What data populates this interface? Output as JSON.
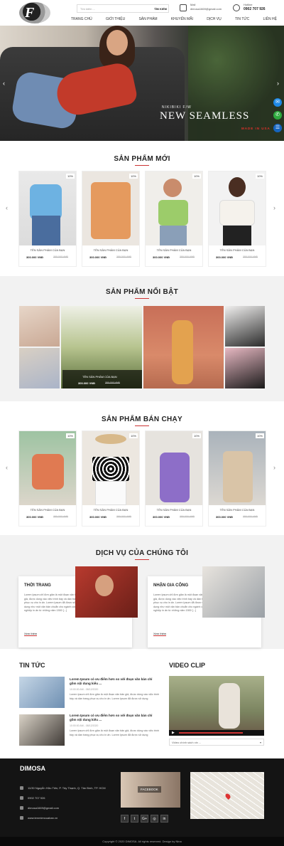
{
  "header": {
    "logo_letter": "F",
    "search_placeholder": "Tìm kiếm ...",
    "search_button": "TÌM KIẾM",
    "mail_label": "Mail",
    "mail_value": "dimosa1669@gmail.com",
    "hotline_label": "Hotline",
    "hotline_value": "0902 707 926",
    "nav": [
      "TRANG CHỦ",
      "GIỚI THIỆU",
      "SẢN PHẨM",
      "KHUYẾN MÃI",
      "DỊCH VỤ",
      "TIN TỨC",
      "LIÊN HỆ"
    ]
  },
  "hero": {
    "subtitle": "NIKIBIKI F/W",
    "title": "NEW SEAMLESS",
    "made": "MADE IN USA"
  },
  "floating": [
    "messenger-icon",
    "zalo-icon",
    "chat-icon"
  ],
  "new_products": {
    "title": "SẢN PHẨM MỚI",
    "items": [
      {
        "badge": "10%",
        "name": "TÊN SẢN PHẨM CỦA BẠN",
        "price": "300.000 VNĐ",
        "old": "350.000 VNĐ"
      },
      {
        "badge": "10%",
        "name": "TÊN SẢN PHẨM CỦA BẠN",
        "price": "300.000 VNĐ",
        "old": "350.000 VNĐ"
      },
      {
        "badge": "10%",
        "name": "TÊN SẢN PHẨM CỦA BẠN",
        "price": "300.000 VNĐ",
        "old": "350.000 VNĐ"
      },
      {
        "badge": "10%",
        "name": "TÊN SẢN PHẨM CỦA BẠN",
        "price": "300.000 VNĐ",
        "old": "350.000 VNĐ"
      }
    ]
  },
  "featured": {
    "title": "SẢN PHẨM NỔI BẬT",
    "caption_name": "TÊN SẢN PHẨM CỦA BẠN",
    "caption_price": "300.000 VNĐ",
    "caption_old": "350.000 VNĐ"
  },
  "best_sellers": {
    "title": "SẢN PHẨM BÁN CHẠY",
    "items": [
      {
        "badge": "10%",
        "name": "TÊN SẢN PHẨM CỦA BẠN",
        "price": "300.000 VNĐ",
        "old": "350.000 VNĐ"
      },
      {
        "badge": "10%",
        "name": "TÊN SẢN PHẨM CỦA BẠN",
        "price": "300.000 VNĐ",
        "old": "350.000 VNĐ"
      },
      {
        "badge": "10%",
        "name": "TÊN SẢN PHẨM CỦA BẠN",
        "price": "300.000 VNĐ",
        "old": "350.000 VNĐ"
      },
      {
        "badge": "10%",
        "name": "TÊN SẢN PHẨM CỦA BẠN",
        "price": "300.000 VNĐ",
        "old": "350.000 VNĐ"
      }
    ]
  },
  "services": {
    "title": "DỊCH VỤ CỦA CHÚNG TÔI",
    "items": [
      {
        "title": "THỜI TRANG",
        "text": "Lorem Ipsum chỉ đơn giản là một đoạn văn bản giả, được dùng vào việc trình bày và dàn trang phục vụ cho in ấn. Lorem Ipsum đã được sử dụng như một văn bản chuẩn cho ngành công nghiệp in ấn từ những năm 1500 [...]",
        "more": "Xem thêm"
      },
      {
        "title": "NHẬN GIA CÔNG",
        "text": "Lorem Ipsum chỉ đơn giản là một đoạn văn bản giả, được dùng vào việc trình bày và dàn trang phục vụ cho in ấn. Lorem Ipsum đã được sử dụng như một văn bản chuẩn cho ngành công nghiệp in ấn từ những năm 1500 [...]",
        "more": "Xem thêm"
      }
    ]
  },
  "news": {
    "title": "TIN TỨC",
    "items": [
      {
        "title": "Lorem Ipsum có ưu điểm hơn so với đoạn văn bản chỉ gồm nội dung kiểu ...",
        "date": "10:00:00 AM - 08/12/2020",
        "text": "Lorem Ipsum chỉ đơn giản là một đoạn văn bản giả, được dùng vào việc trình bày và dàn trang phục vụ cho in ấn. Lorem Ipsum đã được sử dụng"
      },
      {
        "title": "Lorem Ipsum có ưu điểm hơn so với đoạn văn bản chỉ gồm nội dung kiểu ...",
        "date": "10:00:00 AM - 08/12/2020",
        "text": "Lorem Ipsum chỉ đơn giản là một đoạn văn bản giả, được dùng vào việc trình bày và dàn trang phục vụ cho in ấn. Lorem Ipsum đã được sử dụng"
      }
    ]
  },
  "video": {
    "title": "VIDEO CLIP",
    "select": "Video chính sách xin ..."
  },
  "footer": {
    "brand": "DIMOSA",
    "address": "11/30 Nguyễn Hữu Tiến, P. Tây Thạnh, Q. Tân Bình, TP. HCM",
    "phone": "0902 707 926",
    "email": "dimosa1669@gmail.com",
    "website": "www.tenmiencuaban.vn",
    "facebook": "FACEBOOK",
    "social": [
      "f",
      "t",
      "G+",
      "◎",
      "in"
    ],
    "copyright": "Copyright © 2020 DIMOSA. All rights reserved. Design by Nina"
  },
  "colors": {
    "accent": "#c33333",
    "dark": "#141414"
  }
}
